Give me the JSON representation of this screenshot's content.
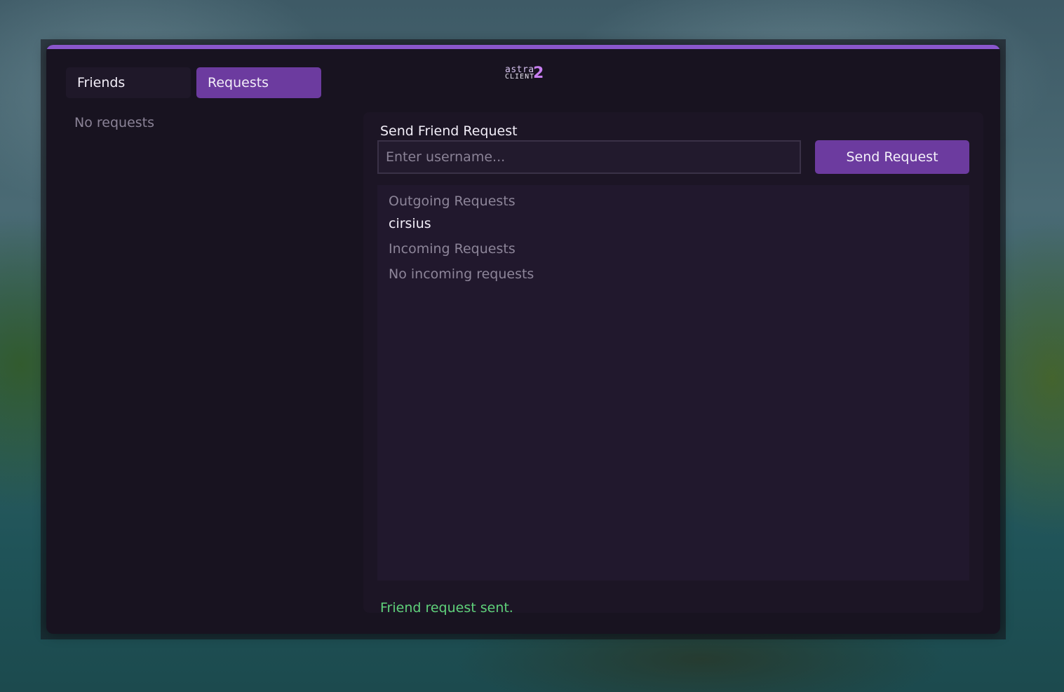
{
  "tabs": {
    "friends": "Friends",
    "requests": "Requests",
    "active": "requests"
  },
  "left_panel": {
    "empty_text": "No requests"
  },
  "logo": {
    "top_text": "astra",
    "bottom_text": "CLIENT",
    "version": "2"
  },
  "send_request": {
    "title": "Send Friend Request",
    "placeholder": "Enter username...",
    "value": "",
    "button_label": "Send Request"
  },
  "outgoing": {
    "heading": "Outgoing Requests",
    "items": [
      "cirsius"
    ]
  },
  "incoming": {
    "heading": "Incoming Requests",
    "empty_text": "No incoming requests"
  },
  "status": {
    "message": "Friend request sent."
  },
  "colors": {
    "accent": "#8a57cc",
    "button": "#6c3b9f",
    "success": "#5fd27a",
    "window_bg": "#181320"
  }
}
